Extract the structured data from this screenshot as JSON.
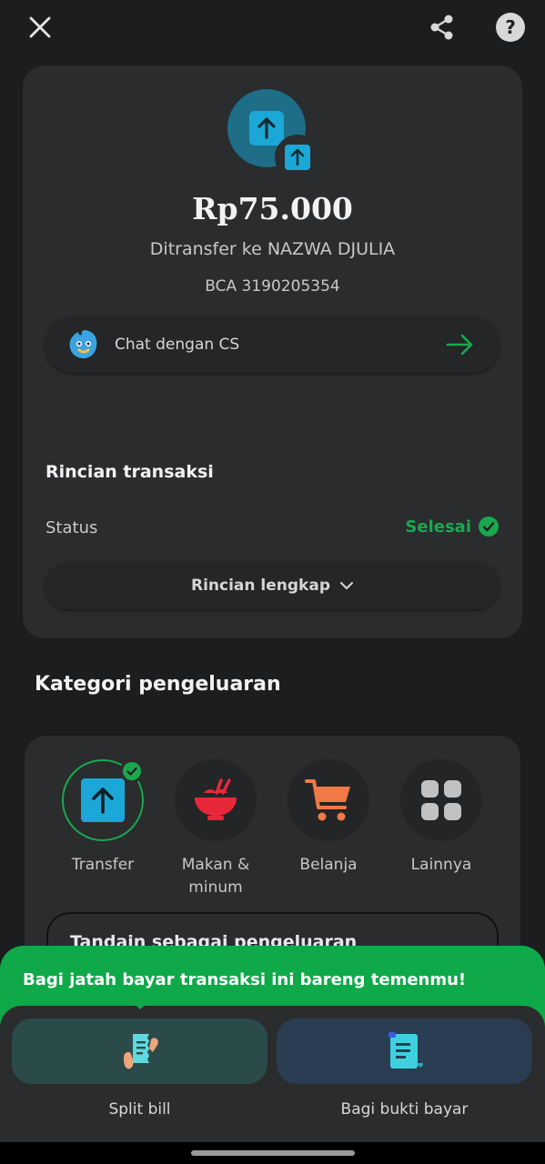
{
  "header": {
    "close_icon": "close-icon",
    "share_icon": "share-icon",
    "help_icon": "help-icon"
  },
  "transaction": {
    "amount": "Rp75.000",
    "recipient": "Ditransfer ke NAZWA DJULIA",
    "account": "BCA 3190205354",
    "icon": "transfer-up-arrow-icon"
  },
  "chat_cs": {
    "label": "Chat dengan CS"
  },
  "details": {
    "title": "Rincian transaksi",
    "status_label": "Status",
    "status_value": "Selesai",
    "full_details_label": "Rincian lengkap"
  },
  "category": {
    "title": "Kategori pengeluaran",
    "items": [
      {
        "label": "Transfer",
        "icon": "transfer-icon",
        "selected": true
      },
      {
        "label": "Makan & minum",
        "icon": "food-bowl-icon",
        "selected": false
      },
      {
        "label": "Belanja",
        "icon": "cart-icon",
        "selected": false
      },
      {
        "label": "Lainnya",
        "icon": "grid-icon",
        "selected": false
      }
    ],
    "mark_label": "Tandain sebagai pengeluaran"
  },
  "split_sheet": {
    "message": "Bagi jatah bayar transaksi ini bareng temenmu!",
    "actions": [
      {
        "label": "Split bill",
        "icon": "split-bill-icon"
      },
      {
        "label": "Bagi bukti bayar",
        "icon": "receipt-icon"
      }
    ]
  },
  "colors": {
    "accent_green": "#0fa94a",
    "status_green": "#1aa84f",
    "transfer_blue": "#1ba8d6"
  }
}
